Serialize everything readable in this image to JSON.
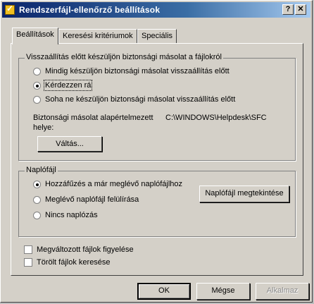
{
  "window": {
    "title": "Rendszerfájl-ellenőrző beállítások",
    "help_glyph": "?",
    "close_glyph": "✕"
  },
  "tabs": [
    {
      "label": "Beállítások",
      "active": true
    },
    {
      "label": "Keresési kritériumok",
      "active": false
    },
    {
      "label": "Speciális",
      "active": false
    }
  ],
  "backup_group": {
    "title": "Visszaállítás előtt készüljön biztonsági másolat a fájlokról",
    "options": [
      {
        "label": "Mindig készüljön biztonsági másolat visszaállítás előtt",
        "selected": false
      },
      {
        "label": "Kérdezzen rá",
        "selected": true
      },
      {
        "label": "Soha ne készüljön biztonsági másolat visszaállítás előtt",
        "selected": false
      }
    ],
    "location_label_line1": "Biztonsági másolat alapértelmezett",
    "location_label_line2": "helye:",
    "location_path": "C:\\WINDOWS\\Helpdesk\\SFC",
    "change_button": "Váltás..."
  },
  "log_group": {
    "title": "Naplófájl",
    "options": [
      {
        "label": "Hozzáfűzés a már meglévő naplófájlhoz",
        "selected": true
      },
      {
        "label": "Meglévő naplófájl felülírása",
        "selected": false
      },
      {
        "label": "Nincs naplózás",
        "selected": false
      }
    ],
    "view_button": "Naplófájl megtekintése"
  },
  "checkboxes": [
    {
      "label": "Megváltozott fájlok figyelése",
      "checked": false
    },
    {
      "label": "Törölt fájlok keresése",
      "checked": false
    }
  ],
  "footer": {
    "ok": "OK",
    "cancel": "Mégse",
    "apply": "Alkalmaz"
  },
  "colors": {
    "face": "#d4d0c8",
    "title_start": "#0a246a",
    "title_end": "#a6caf0"
  }
}
